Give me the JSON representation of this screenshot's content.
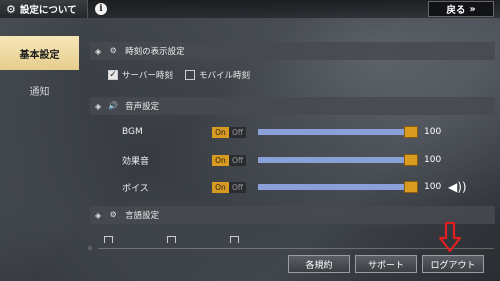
{
  "header": {
    "title": "設定について",
    "back_label": "戻る",
    "back_arrow": "»"
  },
  "sidebar": {
    "items": [
      {
        "label": "基本設定",
        "active": true
      },
      {
        "label": "通知",
        "active": false
      }
    ]
  },
  "sections": {
    "time_display": {
      "title": "時刻の表示設定",
      "options": [
        {
          "label": "サーバー時刻",
          "checked": true
        },
        {
          "label": "モバイル時刻",
          "checked": false
        }
      ]
    },
    "sound": {
      "title": "音声設定",
      "rows": [
        {
          "label": "BGM",
          "on_label": "On",
          "off_label": "Off",
          "value": "100"
        },
        {
          "label": "効果音",
          "on_label": "On",
          "off_label": "Off",
          "value": "100"
        },
        {
          "label": "ボイス",
          "on_label": "On",
          "off_label": "Off",
          "value": "100"
        }
      ]
    },
    "language": {
      "title": "言語設定"
    }
  },
  "footer": {
    "buttons": {
      "terms": "各規約",
      "support": "サポート",
      "logout": "ログアウト"
    }
  },
  "colors": {
    "accent_gold": "#d99a20",
    "sidebar_active": "#f2dfa8",
    "marker_red": "#e02020"
  },
  "icons": {
    "settings": "gear-icon",
    "info": "info-icon",
    "sound": "speaker-icon",
    "marker": "red-arrow-down-icon"
  }
}
